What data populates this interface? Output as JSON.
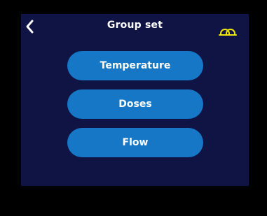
{
  "header": {
    "title": "Group set",
    "back_icon": "chevron-left-icon",
    "status_icon": "double-ring-icon"
  },
  "menu": {
    "items": [
      {
        "label": "Temperature"
      },
      {
        "label": "Doses"
      },
      {
        "label": "Flow"
      }
    ]
  },
  "colors": {
    "screen_background": "#0f1445",
    "button": "#1677c6",
    "status_icon": "#f2e600",
    "text": "#ffffff"
  }
}
